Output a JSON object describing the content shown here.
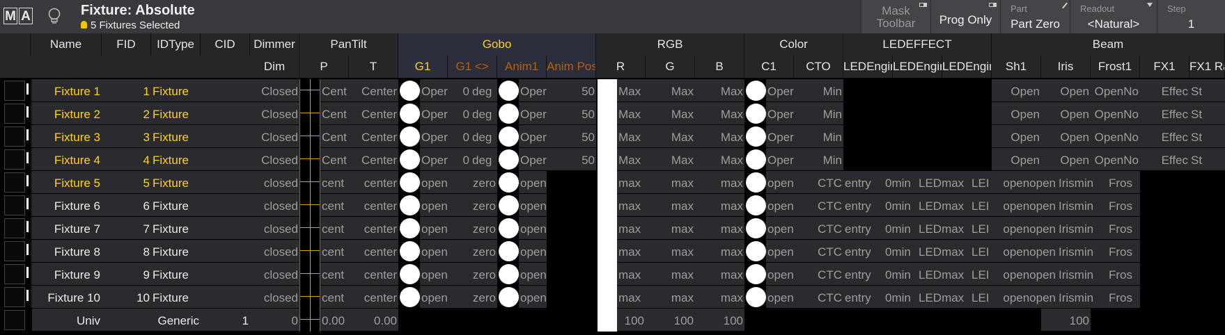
{
  "titlebar": {
    "logo_m": "M",
    "logo_a": "A",
    "title": "Fixture: Absolute",
    "selection": "5 Fixtures Selected",
    "buttons": {
      "mask_line1": "Mask",
      "mask_line2": "Toolbar",
      "prog_only": "Prog Only",
      "part_label": "Part",
      "part_value": "Part Zero",
      "readout_label": "Readout",
      "readout_value": "<Natural>",
      "step_label": "Step",
      "step_value": "1"
    }
  },
  "headers": {
    "name": "Name",
    "fid": "FID",
    "idtype": "IDType",
    "cid": "CID",
    "dimmer": "Dimmer",
    "dim": "Dim",
    "pantilt": "PanTilt",
    "p": "P",
    "t": "T",
    "gobo": "Gobo",
    "g1": "G1",
    "g1rot": "G1 <>",
    "anim1": "Anim1",
    "animpos": "Anim Pos",
    "rgb": "RGB",
    "r": "R",
    "g": "G",
    "b": "B",
    "color": "Color",
    "c1": "C1",
    "cto": "CTO",
    "ledeffect": "LEDEFFECT",
    "led1": "LEDEngir",
    "led2": "LEDEngir",
    "led3": "LEDEngir",
    "beam": "Beam",
    "sh1": "Sh1",
    "iris": "Iris",
    "frost1": "Frost1",
    "fx1": "FX1",
    "fx1r": "FX1 Ra"
  },
  "rows": [
    {
      "name": "Fixture 1",
      "fid": "1",
      "idtype": "Fixture",
      "dim": "Closed",
      "p": "Cent",
      "t": "Center",
      "g1": "Oper",
      "g1rot": "0",
      "deg": "deg",
      "anim1": "Oper",
      "animpos": "50",
      "r": "Max",
      "g": "Max",
      "b": "Max",
      "c1": "Oper",
      "cto": "Min",
      "sh1": "Open",
      "iris": "Open",
      "frost1": "OpenNo",
      "fx1": "Effec",
      "fx1r": "St"
    },
    {
      "name": "Fixture 2",
      "fid": "2",
      "idtype": "Fixture",
      "dim": "Closed",
      "p": "Cent",
      "t": "Center",
      "g1": "Oper",
      "g1rot": "0",
      "deg": "deg",
      "anim1": "Oper",
      "animpos": "50",
      "r": "Max",
      "g": "Max",
      "b": "Max",
      "c1": "Oper",
      "cto": "Min",
      "sh1": "Open",
      "iris": "Open",
      "frost1": "OpenNo",
      "fx1": "Effec",
      "fx1r": "St"
    },
    {
      "name": "Fixture 3",
      "fid": "3",
      "idtype": "Fixture",
      "dim": "Closed",
      "p": "Cent",
      "t": "Center",
      "g1": "Oper",
      "g1rot": "0",
      "deg": "deg",
      "anim1": "Oper",
      "animpos": "50",
      "r": "Max",
      "g": "Max",
      "b": "Max",
      "c1": "Oper",
      "cto": "Min",
      "sh1": "Open",
      "iris": "Open",
      "frost1": "OpenNo",
      "fx1": "Effec",
      "fx1r": "St"
    },
    {
      "name": "Fixture 4",
      "fid": "4",
      "idtype": "Fixture",
      "dim": "Closed",
      "p": "Cent",
      "t": "Center",
      "g1": "Oper",
      "g1rot": "0",
      "deg": "deg",
      "anim1": "Oper",
      "animpos": "50",
      "r": "Max",
      "g": "Max",
      "b": "Max",
      "c1": "Oper",
      "cto": "Min",
      "sh1": "Open",
      "iris": "Open",
      "frost1": "OpenNo",
      "fx1": "Effec",
      "fx1r": "St"
    },
    {
      "name": "Fixture 5",
      "fid": "5",
      "idtype": "Fixture",
      "dim": "closed",
      "p": "cent",
      "t": "center",
      "g1": "open",
      "g1rot": "zero",
      "anim1": "open",
      "r": "max",
      "g": "max",
      "b": "max",
      "c1": "openmin",
      "cto": "CTC",
      "led1": "entry",
      "led2": "0min",
      "led3": "LEDmax",
      "led4": "LEI",
      "sh1": "openopen",
      "iris": "Irismin",
      "frost1": "Fros"
    },
    {
      "name": "Fixture 6",
      "fid": "6",
      "idtype": "Fixture",
      "dim": "closed",
      "p": "cent",
      "t": "center",
      "g1": "open",
      "g1rot": "zero",
      "anim1": "open",
      "r": "max",
      "g": "max",
      "b": "max",
      "c1": "openmin",
      "cto": "CTC",
      "led1": "entry",
      "led2": "0min",
      "led3": "LEDmax",
      "led4": "LEI",
      "sh1": "openopen",
      "iris": "Irismin",
      "frost1": "Fros"
    },
    {
      "name": "Fixture 7",
      "fid": "7",
      "idtype": "Fixture",
      "dim": "closed",
      "p": "cent",
      "t": "center",
      "g1": "open",
      "g1rot": "zero",
      "anim1": "open",
      "r": "max",
      "g": "max",
      "b": "max",
      "c1": "openmin",
      "cto": "CTC",
      "led1": "entry",
      "led2": "0min",
      "led3": "LEDmax",
      "led4": "LEI",
      "sh1": "openopen",
      "iris": "Irismin",
      "frost1": "Fros"
    },
    {
      "name": "Fixture 8",
      "fid": "8",
      "idtype": "Fixture",
      "dim": "closed",
      "p": "cent",
      "t": "center",
      "g1": "open",
      "g1rot": "zero",
      "anim1": "open",
      "r": "max",
      "g": "max",
      "b": "max",
      "c1": "openmin",
      "cto": "CTC",
      "led1": "entry",
      "led2": "0min",
      "led3": "LEDmax",
      "led4": "LEI",
      "sh1": "openopen",
      "iris": "Irismin",
      "frost1": "Fros"
    },
    {
      "name": "Fixture 9",
      "fid": "9",
      "idtype": "Fixture",
      "dim": "closed",
      "p": "cent",
      "t": "center",
      "g1": "open",
      "g1rot": "zero",
      "anim1": "open",
      "r": "max",
      "g": "max",
      "b": "max",
      "c1": "openmin",
      "cto": "CTC",
      "led1": "entry",
      "led2": "0min",
      "led3": "LEDmax",
      "led4": "LEI",
      "sh1": "openopen",
      "iris": "Irismin",
      "frost1": "Fros"
    },
    {
      "name": "Fixture 10",
      "fid": "10",
      "idtype": "Fixture",
      "dim": "closed",
      "p": "cent",
      "t": "center",
      "g1": "open",
      "g1rot": "zero",
      "anim1": "open",
      "r": "max",
      "g": "max",
      "b": "max",
      "c1": "openmin",
      "cto": "CTC",
      "led1": "entry",
      "led2": "0min",
      "led3": "LEDmax",
      "led4": "LEI",
      "sh1": "openopen",
      "iris": "Irismin",
      "frost1": "Fros"
    }
  ],
  "univ": {
    "name": "Univ",
    "idtype": "Generic",
    "cid": "1",
    "dim": "0",
    "p": "0.00",
    "t": "0.00",
    "r": "100",
    "g": "100",
    "b": "100",
    "iris": "100"
  },
  "colors": {
    "title_bar": "#3a3a3e",
    "header": "#262629",
    "selected_name": "#ffd21a",
    "gobo_header": "#ffd21a",
    "gobo_sub_dim": "#b8610d"
  }
}
